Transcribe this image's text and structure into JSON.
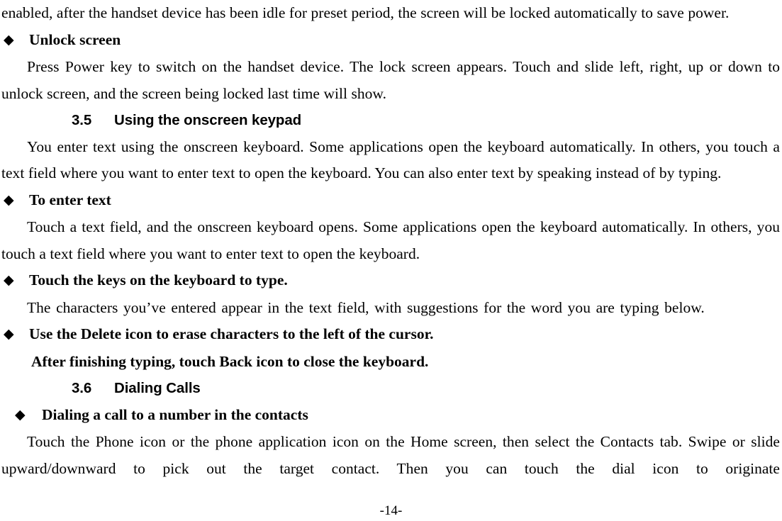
{
  "document": {
    "page_number_label": "-14-",
    "bullet_glyph": "◆"
  },
  "blocks": {
    "intro_paragraph": "enabled, after the handset device has been idle for preset period, the screen will be locked automatically to save power.",
    "unlock_screen_heading": "Unlock screen",
    "unlock_screen_body": "Press Power key to switch on the handset device. The lock screen appears. Touch and slide left, right, up or down to unlock screen, and the screen being locked last time will show.",
    "section_3_5": {
      "number": "3.5",
      "title": "Using the onscreen keypad"
    },
    "keypad_intro": "You enter text using the onscreen keyboard. Some applications open the keyboard automatically. In others, you touch a text field where you want to enter text to open the keyboard. You can also enter text by speaking instead of by typing.",
    "to_enter_text_heading": "To enter text",
    "to_enter_text_body": "Touch a text field, and the onscreen keyboard opens. Some applications open the keyboard automatically. In others, you touch a text field where you want to enter text to open the keyboard.",
    "touch_keys_heading": "Touch the keys on the keyboard to type.",
    "touch_keys_body": "The characters you’ve entered appear in the text field, with suggestions for the word you are typing below.",
    "delete_icon_heading": "Use the Delete icon to erase characters to the left of the cursor.",
    "delete_icon_continuation": "After finishing typing, touch Back icon to close the keyboard.",
    "section_3_6": {
      "number": "3.6",
      "title": "Dialing Calls"
    },
    "dialing_contacts_heading": "Dialing a call to a number in the contacts",
    "dialing_contacts_body": "Touch the Phone icon or the phone application icon on the Home screen, then select the Contacts tab. Swipe or slide upward/downward to pick out the target contact. Then you can touch the dial icon to originate"
  }
}
